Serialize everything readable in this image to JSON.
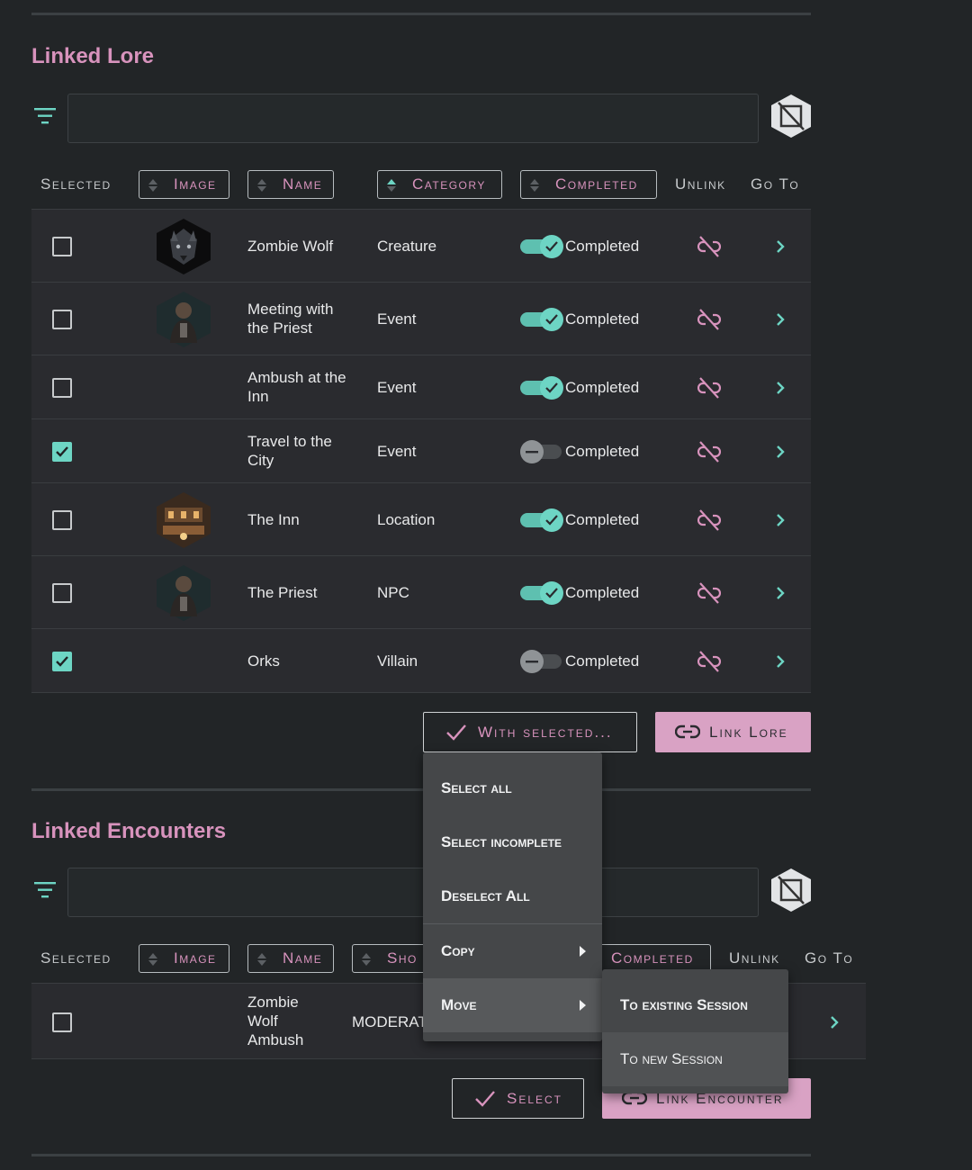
{
  "lore": {
    "title": "Linked Lore",
    "search_value": "",
    "headers": {
      "selected": "Selected",
      "image": "Image",
      "name": "Name",
      "category": "Category",
      "completed": "Completed",
      "unlink": "Unlink",
      "goto": "Go To"
    },
    "rows": [
      {
        "name": "Zombie Wolf",
        "category": "Creature",
        "completed": true,
        "selected": false,
        "avatar": "wolf"
      },
      {
        "name": "Meeting with the Priest",
        "category": "Event",
        "completed": true,
        "selected": false,
        "avatar": "priest"
      },
      {
        "name": "Ambush at the Inn",
        "category": "Event",
        "completed": true,
        "selected": false,
        "avatar": ""
      },
      {
        "name": "Travel to the City",
        "category": "Event",
        "completed": false,
        "selected": true,
        "avatar": ""
      },
      {
        "name": "The Inn",
        "category": "Location",
        "completed": true,
        "selected": false,
        "avatar": "inn"
      },
      {
        "name": "The Priest",
        "category": "NPC",
        "completed": true,
        "selected": false,
        "avatar": "priest"
      },
      {
        "name": "Orks",
        "category": "Villain",
        "completed": false,
        "selected": true,
        "avatar": ""
      }
    ],
    "completed_label": "Completed",
    "with_selected_label": "With selected...",
    "link_label": "Link Lore"
  },
  "encounters": {
    "title": "Linked Encounters",
    "search_value": "",
    "headers": {
      "selected": "Selected",
      "image": "Image",
      "name": "Name",
      "short": "Sho",
      "completed": "Completed",
      "unlink": "Unlink",
      "goto": "Go To"
    },
    "rows": [
      {
        "name": "Zombie Wolf Ambush",
        "difficulty": "MODERAT",
        "selected": false
      }
    ],
    "select_label": "Select",
    "link_label": "Link Encounter"
  },
  "menu": {
    "items": [
      "Select all",
      "Select incomplete",
      "Deselect All",
      "Copy",
      "Move"
    ],
    "submenu": [
      "To existing Session",
      "To new Session"
    ]
  },
  "colors": {
    "accent_pink": "#d893bd",
    "accent_teal": "#6dd5c4",
    "background": "#222527",
    "row_bg": "#2a2b2f"
  }
}
